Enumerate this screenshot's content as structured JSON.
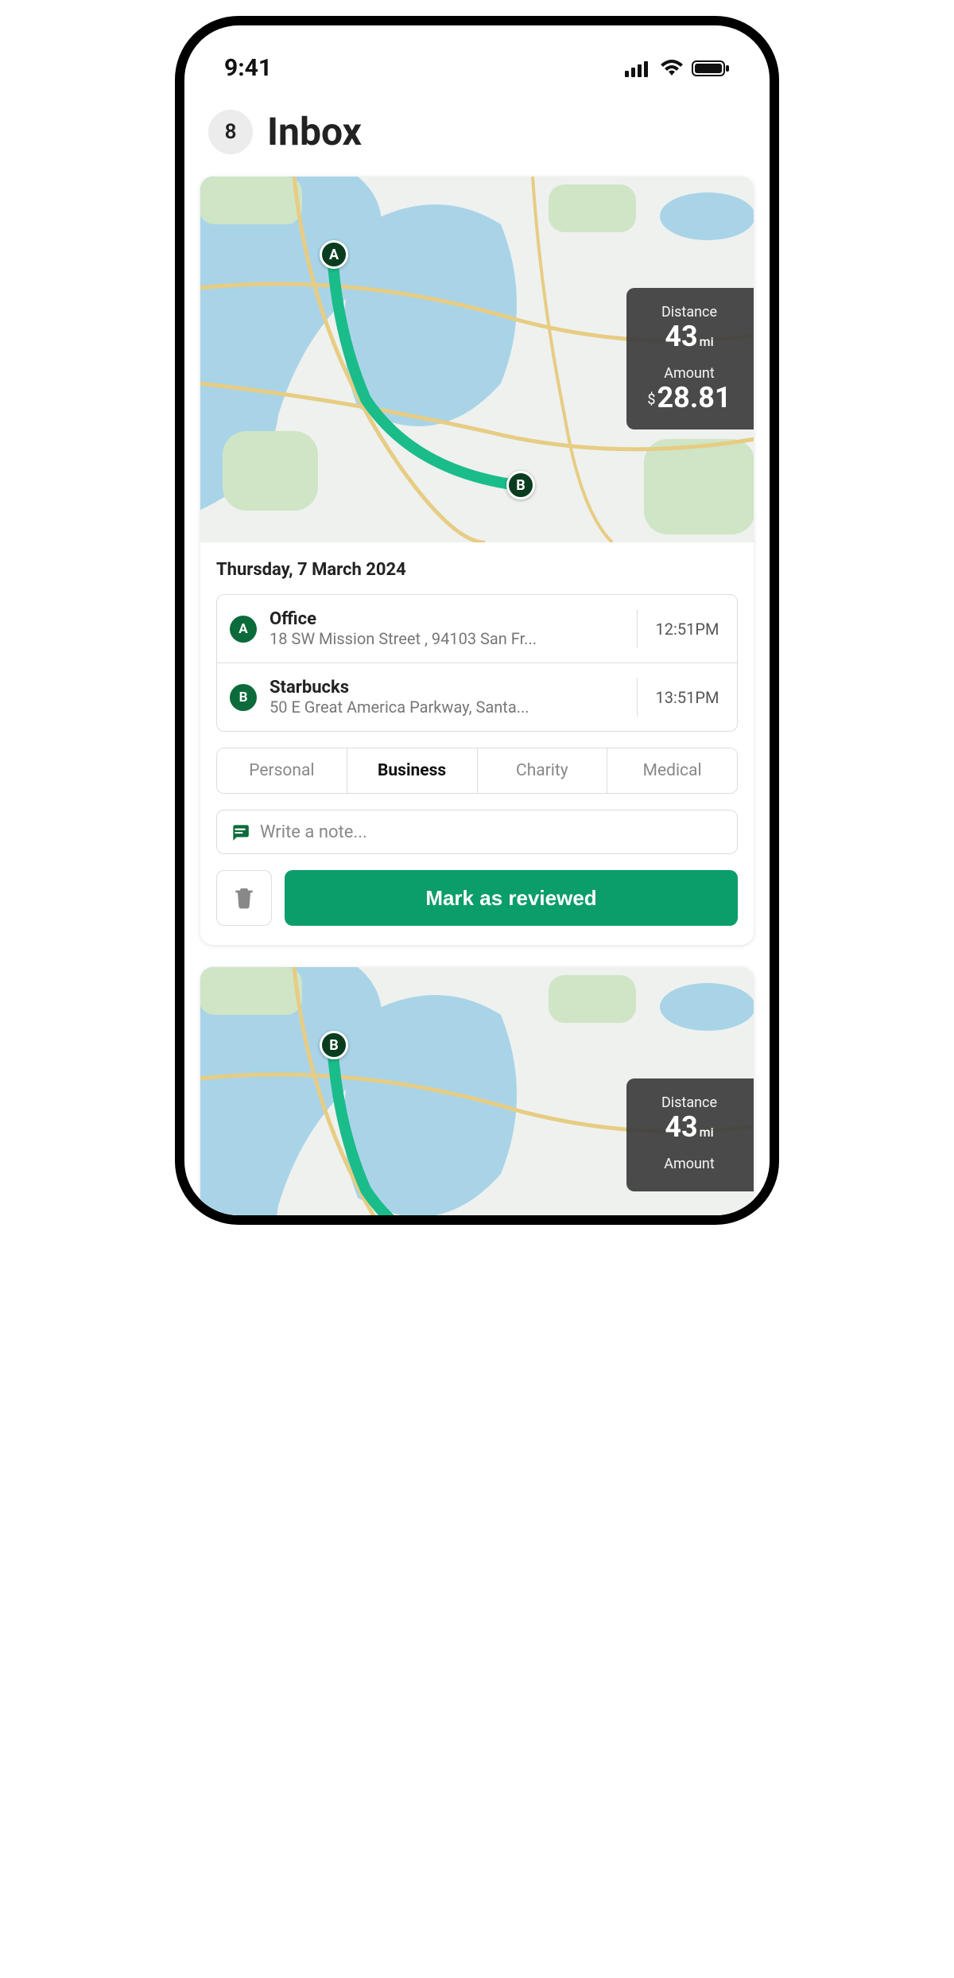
{
  "status": {
    "time": "9:41"
  },
  "header": {
    "count": "8",
    "title": "Inbox"
  },
  "cards": [
    {
      "date": "Thursday, 7 March 2024",
      "distance_label": "Distance",
      "distance_value": "43",
      "distance_unit": "mi",
      "amount_label": "Amount",
      "amount_value": "28.81",
      "pins": {
        "a": "A",
        "b": "B"
      },
      "stops": [
        {
          "letter": "A",
          "name": "Office",
          "address": "18 SW Mission Street , 94103 San Fr...",
          "time": "12:51PM"
        },
        {
          "letter": "B",
          "name": "Starbucks",
          "address": "50 E Great America Parkway, Santa...",
          "time": "13:51PM"
        }
      ],
      "categories": [
        "Personal",
        "Business",
        "Charity",
        "Medical"
      ],
      "active_category": "Business",
      "note_placeholder": "Write a note...",
      "review_label": "Mark as reviewed"
    },
    {
      "distance_label": "Distance",
      "distance_value": "43",
      "distance_unit": "mi",
      "amount_label": "Amount",
      "pins": {
        "b": "B"
      }
    }
  ]
}
